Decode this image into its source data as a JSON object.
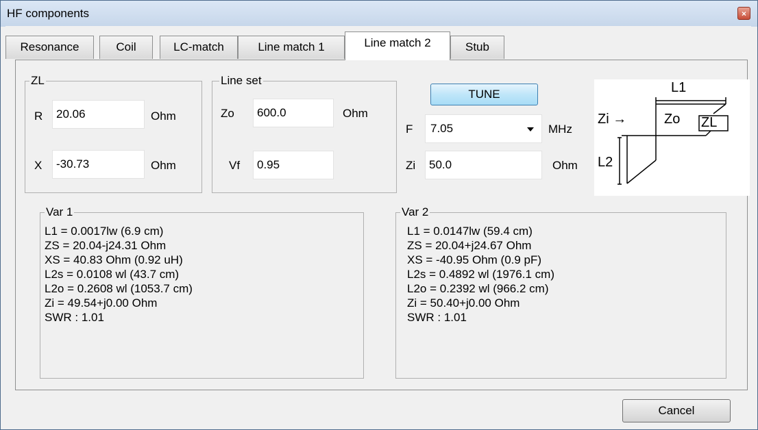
{
  "window": {
    "title": "HF components",
    "close_icon": "×"
  },
  "tabs": [
    {
      "label": "Resonance",
      "active": false
    },
    {
      "label": "Coil",
      "active": false
    },
    {
      "label": "LC-match",
      "active": false
    },
    {
      "label": "Line match  1",
      "active": false
    },
    {
      "label": "Line match 2",
      "active": true
    },
    {
      "label": "Stub",
      "active": false
    }
  ],
  "zl": {
    "legend": "ZL",
    "r_label": "R",
    "r_value": "20.06",
    "r_unit": "Ohm",
    "x_label": "X",
    "x_value": "-30.73",
    "x_unit": "Ohm"
  },
  "line_set": {
    "legend": "Line set",
    "zo_label": "Zo",
    "zo_value": "600.0",
    "zo_unit": "Ohm",
    "vf_label": "Vf",
    "vf_value": "0.95"
  },
  "tune": {
    "button_label": "TUNE",
    "f_label": "F",
    "f_value": "7.05",
    "f_unit": "MHz",
    "zi_label": "Zi",
    "zi_value": "50.0",
    "zi_unit": "Ohm"
  },
  "diagram": {
    "l1_label": "L1",
    "zi_label": "Zi →",
    "zo_label": "Zo",
    "zl_label": "ZL",
    "l2_label": "L2"
  },
  "var1": {
    "legend": "Var 1",
    "lines": [
      "L1 = 0.0017lw (6.9 cm)",
      "ZS = 20.04-j24.31 Ohm",
      "XS = 40.83 Ohm (0.92 uH)",
      "L2s = 0.0108 wl (43.7 cm)",
      "L2o = 0.2608 wl (1053.7 cm)",
      "Zi = 49.54+j0.00 Ohm",
      "SWR : 1.01"
    ]
  },
  "var2": {
    "legend": "Var 2",
    "lines": [
      "L1 = 0.0147lw (59.4 cm)",
      "ZS = 20.04+j24.67 Ohm",
      "XS = -40.95 Ohm (0.9 pF)",
      "L2s = 0.4892 wl (1976.1 cm)",
      "L2o = 0.2392 wl (966.2 cm)",
      "Zi = 50.40+j0.00 Ohm",
      "SWR : 1.01"
    ]
  },
  "footer": {
    "cancel_label": "Cancel"
  },
  "colors": {
    "tune_button": "#bfe6f9",
    "close_button": "#c74d38",
    "title_bar": "#dbe7f5"
  }
}
